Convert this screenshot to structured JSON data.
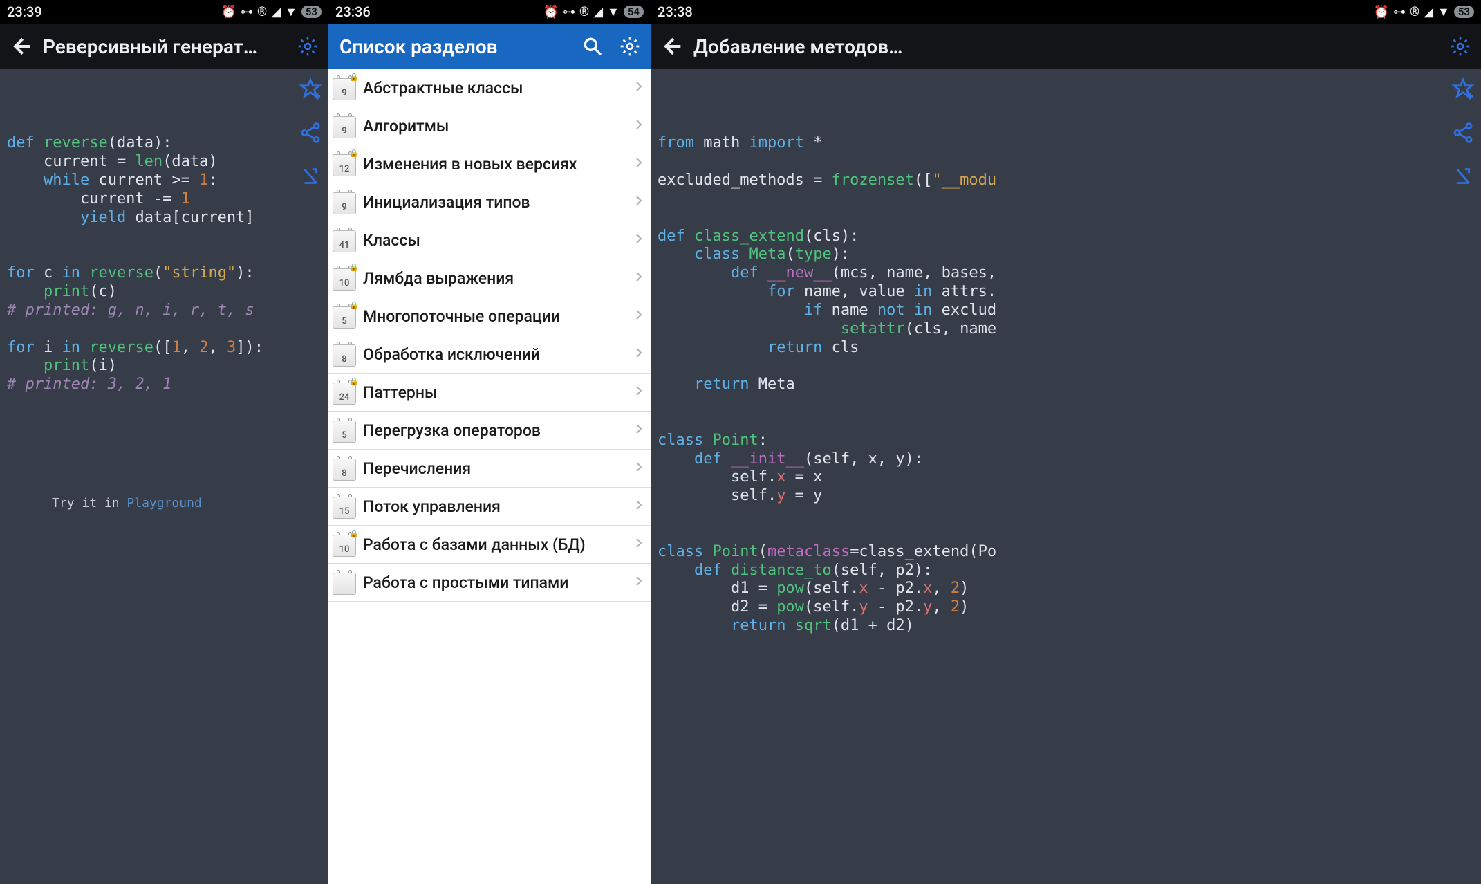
{
  "left": {
    "status": {
      "time": "23:39",
      "battery": "53"
    },
    "title": "Реверсивный генерат…",
    "code_lines": [
      [
        [
          "kw",
          "def"
        ],
        [
          "pl",
          " "
        ],
        [
          "def",
          "reverse"
        ],
        [
          "pl",
          "(data):"
        ]
      ],
      [
        [
          "pl",
          "    current = "
        ],
        [
          "fn",
          "len"
        ],
        [
          "pl",
          "(data)"
        ]
      ],
      [
        [
          "pl",
          "    "
        ],
        [
          "kw",
          "while"
        ],
        [
          "pl",
          " current "
        ],
        [
          "pl",
          ">= "
        ],
        [
          "num",
          "1"
        ],
        [
          "pl",
          ":"
        ]
      ],
      [
        [
          "pl",
          "        current -= "
        ],
        [
          "num",
          "1"
        ]
      ],
      [
        [
          "pl",
          "        "
        ],
        [
          "kw",
          "yield"
        ],
        [
          "pl",
          " data[current]"
        ]
      ],
      [
        [
          "pl",
          ""
        ]
      ],
      [
        [
          "pl",
          ""
        ]
      ],
      [
        [
          "kw",
          "for"
        ],
        [
          "pl",
          " c "
        ],
        [
          "kw",
          "in"
        ],
        [
          "pl",
          " "
        ],
        [
          "def",
          "reverse"
        ],
        [
          "pl",
          "("
        ],
        [
          "str",
          "\"string\""
        ],
        [
          "pl",
          "):"
        ]
      ],
      [
        [
          "pl",
          "    "
        ],
        [
          "fn",
          "print"
        ],
        [
          "pl",
          "(c)"
        ]
      ],
      [
        [
          "cmt",
          "# printed: g, n, i, r, t, s"
        ]
      ],
      [
        [
          "pl",
          ""
        ]
      ],
      [
        [
          "kw",
          "for"
        ],
        [
          "pl",
          " i "
        ],
        [
          "kw",
          "in"
        ],
        [
          "pl",
          " "
        ],
        [
          "def",
          "reverse"
        ],
        [
          "pl",
          "(["
        ],
        [
          "num",
          "1"
        ],
        [
          "pl",
          ", "
        ],
        [
          "num",
          "2"
        ],
        [
          "pl",
          ", "
        ],
        [
          "num",
          "3"
        ],
        [
          "pl",
          "]):"
        ]
      ],
      [
        [
          "pl",
          "    "
        ],
        [
          "fn",
          "print"
        ],
        [
          "pl",
          "(i)"
        ]
      ],
      [
        [
          "cmt",
          "# printed: 3, 2, 1"
        ]
      ]
    ],
    "try_prefix": "Try it in ",
    "try_link": "Playground"
  },
  "mid": {
    "status": {
      "time": "23:36",
      "battery": "54"
    },
    "title": "Список разделов",
    "items": [
      {
        "count": "9",
        "label": "Абстрактные классы",
        "locked": true
      },
      {
        "count": "9",
        "label": "Алгоритмы",
        "locked": false
      },
      {
        "count": "12",
        "label": "Изменения в новых версиях",
        "locked": true
      },
      {
        "count": "9",
        "label": "Инициализация типов",
        "locked": false
      },
      {
        "count": "41",
        "label": "Классы",
        "locked": false
      },
      {
        "count": "10",
        "label": "Лямбда выражения",
        "locked": true
      },
      {
        "count": "5",
        "label": "Многопоточные операции",
        "locked": true
      },
      {
        "count": "8",
        "label": "Обработка исключений",
        "locked": false
      },
      {
        "count": "24",
        "label": "Паттерны",
        "locked": true
      },
      {
        "count": "5",
        "label": "Перегрузка операторов",
        "locked": false
      },
      {
        "count": "8",
        "label": "Перечисления",
        "locked": false
      },
      {
        "count": "15",
        "label": "Поток управления",
        "locked": false
      },
      {
        "count": "10",
        "label": "Работа с базами данных (БД)",
        "locked": true
      },
      {
        "count": "",
        "label": "Работа с простыми типами",
        "locked": false
      }
    ]
  },
  "right": {
    "status": {
      "time": "23:38",
      "battery": "53"
    },
    "title": "Добавление методов…",
    "code_lines": [
      [
        [
          "kw",
          "from"
        ],
        [
          "pl",
          " math "
        ],
        [
          "kw",
          "import"
        ],
        [
          "pl",
          " *"
        ]
      ],
      [
        [
          "pl",
          ""
        ]
      ],
      [
        [
          "pl",
          "excluded_methods = "
        ],
        [
          "fn",
          "frozenset"
        ],
        [
          "pl",
          "(["
        ],
        [
          "str",
          "\"__modu"
        ]
      ],
      [
        [
          "pl",
          ""
        ]
      ],
      [
        [
          "pl",
          ""
        ]
      ],
      [
        [
          "kw",
          "def"
        ],
        [
          "pl",
          " "
        ],
        [
          "def",
          "class_extend"
        ],
        [
          "pl",
          "(cls):"
        ]
      ],
      [
        [
          "pl",
          "    "
        ],
        [
          "kw",
          "class"
        ],
        [
          "pl",
          " "
        ],
        [
          "def",
          "Meta"
        ],
        [
          "pl",
          "("
        ],
        [
          "fn",
          "type"
        ],
        [
          "pl",
          "):"
        ]
      ],
      [
        [
          "pl",
          "        "
        ],
        [
          "kw",
          "def"
        ],
        [
          "pl",
          " "
        ],
        [
          "dund",
          "__new__"
        ],
        [
          "pl",
          "(mcs, name, bases,"
        ]
      ],
      [
        [
          "pl",
          "            "
        ],
        [
          "kw",
          "for"
        ],
        [
          "pl",
          " name, value "
        ],
        [
          "kw",
          "in"
        ],
        [
          "pl",
          " attrs."
        ]
      ],
      [
        [
          "pl",
          "                "
        ],
        [
          "kw",
          "if"
        ],
        [
          "pl",
          " name "
        ],
        [
          "kw",
          "not in"
        ],
        [
          "pl",
          " exclud"
        ]
      ],
      [
        [
          "pl",
          "                    "
        ],
        [
          "fn",
          "setattr"
        ],
        [
          "pl",
          "(cls, name"
        ]
      ],
      [
        [
          "pl",
          "            "
        ],
        [
          "kw",
          "return"
        ],
        [
          "pl",
          " cls"
        ]
      ],
      [
        [
          "pl",
          ""
        ]
      ],
      [
        [
          "pl",
          "    "
        ],
        [
          "kw",
          "return"
        ],
        [
          "pl",
          " Meta"
        ]
      ],
      [
        [
          "pl",
          ""
        ]
      ],
      [
        [
          "pl",
          ""
        ]
      ],
      [
        [
          "kw",
          "class"
        ],
        [
          "pl",
          " "
        ],
        [
          "def",
          "Point"
        ],
        [
          "pl",
          ":"
        ]
      ],
      [
        [
          "pl",
          "    "
        ],
        [
          "kw",
          "def"
        ],
        [
          "pl",
          " "
        ],
        [
          "dund",
          "__init__"
        ],
        [
          "pl",
          "(self, x, y):"
        ]
      ],
      [
        [
          "pl",
          "        self."
        ],
        [
          "attr",
          "x"
        ],
        [
          "pl",
          " = x"
        ]
      ],
      [
        [
          "pl",
          "        self."
        ],
        [
          "attr",
          "y"
        ],
        [
          "pl",
          " = y"
        ]
      ],
      [
        [
          "pl",
          ""
        ]
      ],
      [
        [
          "pl",
          ""
        ]
      ],
      [
        [
          "kw",
          "class"
        ],
        [
          "pl",
          " "
        ],
        [
          "def",
          "Point"
        ],
        [
          "pl",
          "("
        ],
        [
          "dund",
          "metaclass"
        ],
        [
          "pl",
          "=class_extend(Po"
        ]
      ],
      [
        [
          "pl",
          "    "
        ],
        [
          "kw",
          "def"
        ],
        [
          "pl",
          " "
        ],
        [
          "def",
          "distance_to"
        ],
        [
          "pl",
          "(self, p2):"
        ]
      ],
      [
        [
          "pl",
          "        d1 = "
        ],
        [
          "fn",
          "pow"
        ],
        [
          "pl",
          "(self."
        ],
        [
          "attr",
          "x"
        ],
        [
          "pl",
          " - p2."
        ],
        [
          "attr",
          "x"
        ],
        [
          "pl",
          ", "
        ],
        [
          "num",
          "2"
        ],
        [
          "pl",
          ")"
        ]
      ],
      [
        [
          "pl",
          "        d2 = "
        ],
        [
          "fn",
          "pow"
        ],
        [
          "pl",
          "(self."
        ],
        [
          "attr",
          "y"
        ],
        [
          "pl",
          " - p2."
        ],
        [
          "attr",
          "y"
        ],
        [
          "pl",
          ", "
        ],
        [
          "num",
          "2"
        ],
        [
          "pl",
          ")"
        ]
      ],
      [
        [
          "pl",
          "        "
        ],
        [
          "kw",
          "return"
        ],
        [
          "pl",
          " "
        ],
        [
          "fn",
          "sqrt"
        ],
        [
          "pl",
          "(d1 + d2)"
        ]
      ]
    ]
  }
}
